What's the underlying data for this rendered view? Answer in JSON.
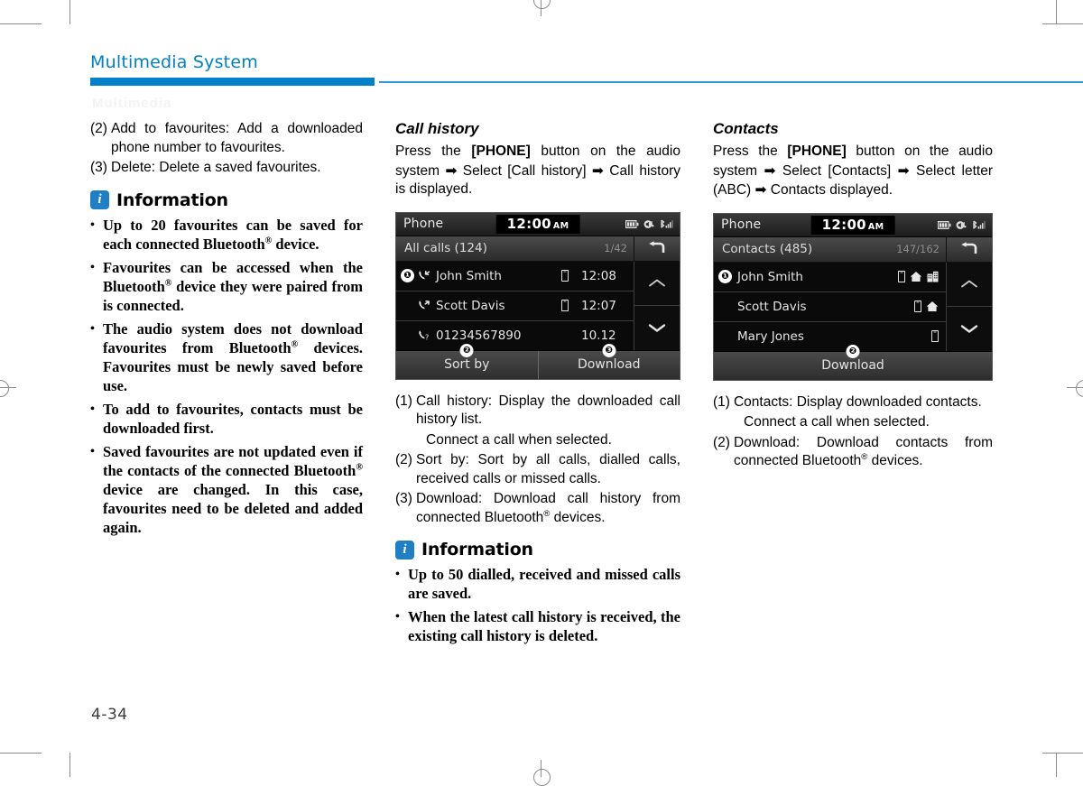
{
  "header": {
    "title": "Multimedia System",
    "ghost_text": "Multimedia"
  },
  "page_number": "4-34",
  "left_column": {
    "items": [
      {
        "marker": "(2)",
        "text": "Add to favourites: Add a downloaded phone number to favourites."
      },
      {
        "marker": "(3)",
        "text": "Delete: Delete a saved favourites."
      }
    ],
    "information": {
      "icon": "info-icon",
      "title": "Information",
      "bullets": [
        "Up to 20 favourites can be saved for each connected Bluetooth® device.",
        "Favourites can be accessed when the Bluetooth® device they were paired from is connected.",
        "The audio system does not download favourites from Bluetooth® devices. Favourites must be newly saved before use.",
        "To add to favourites, contacts must be downloaded first.",
        "Saved favourites are not updated even if the contacts of the connected Bluetooth® device are changed. In this case, favourites need to be deleted and added again."
      ]
    }
  },
  "middle_column": {
    "heading": "Call history",
    "intro_parts": {
      "p1": "Press the ",
      "bold1": "[PHONE]",
      "p2": " button on the audio system ",
      "arrow1": "➡",
      "p3": " Select [Call history] ",
      "arrow2": "➡",
      "p4": " Call history is displayed."
    },
    "device": {
      "app_name": "Phone",
      "clock_time": "12:00",
      "clock_ampm": "AM",
      "status_icons": [
        "battery-icon",
        "mute-audio-icon",
        "bluetooth-signal-icon"
      ],
      "list_title": "All calls (124)",
      "list_count": "1/42",
      "back_icon": "back-arrow-icon",
      "rows": [
        {
          "callout": "❶",
          "call_type": "incoming-call-icon",
          "name": "John Smith",
          "device_icon": "mobile-icon",
          "time": "12:08"
        },
        {
          "callout": "",
          "call_type": "outgoing-call-icon",
          "name": "Scott Davis",
          "device_icon": "mobile-icon",
          "time": "12:07"
        },
        {
          "callout": "",
          "call_type": "missed-call-icon",
          "name": "01234567890",
          "device_icon": "",
          "time": "10.12"
        }
      ],
      "scroll_up": "chevron-up-icon",
      "scroll_down": "chevron-down-icon",
      "footer_buttons": [
        {
          "callout": "❷",
          "label": "Sort by"
        },
        {
          "callout": "❸",
          "label": "Download"
        }
      ]
    },
    "items": [
      {
        "marker": "(1)",
        "text": "Call history: Display the downloaded call history list."
      },
      {
        "marker": "",
        "text": "Connect a call when selected."
      },
      {
        "marker": "(2)",
        "text": "Sort by: Sort by all calls, dialled calls, received calls or missed calls."
      },
      {
        "marker": "(3)",
        "text": "Download: Download call history from connected Bluetooth® devices."
      }
    ],
    "information": {
      "icon": "info-icon",
      "title": "Information",
      "bullets": [
        "Up to 50 dialled, received and missed calls are saved.",
        "When the latest call history is received, the existing call history is deleted."
      ]
    }
  },
  "right_column": {
    "heading": "Contacts",
    "intro_parts": {
      "p1": "Press the ",
      "bold1": "[PHONE]",
      "p2": " button on the audio system ",
      "arrow1": "➡",
      "p3": " Select [Contacts] ",
      "arrow2": "➡",
      "p4": " Select letter (ABC) ",
      "arrow3": "➡",
      "p5": " Contacts displayed."
    },
    "device": {
      "app_name": "Phone",
      "clock_time": "12:00",
      "clock_ampm": "AM",
      "status_icons": [
        "battery-icon",
        "mute-audio-icon",
        "bluetooth-signal-icon"
      ],
      "list_title": "Contacts (485)",
      "list_count": "147/162",
      "back_icon": "back-arrow-icon",
      "rows": [
        {
          "callout": "❶",
          "name": "John Smith",
          "icons": [
            "mobile-icon",
            "home-icon",
            "office-icon"
          ]
        },
        {
          "callout": "",
          "name": "Scott Davis",
          "icons": [
            "mobile-icon",
            "home-icon"
          ]
        },
        {
          "callout": "",
          "name": "Mary Jones",
          "icons": [
            "mobile-icon"
          ]
        }
      ],
      "scroll_up": "chevron-up-icon",
      "scroll_down": "chevron-down-icon",
      "footer_buttons": [
        {
          "callout": "❷",
          "label": "Download"
        }
      ]
    },
    "items": [
      {
        "marker": "(1)",
        "text": "Contacts: Display downloaded contacts."
      },
      {
        "marker": "",
        "text": "Connect a call when selected."
      },
      {
        "marker": "(2)",
        "text": "Download: Download contacts from connected Bluetooth® devices."
      }
    ]
  },
  "colors": {
    "brand_blue": "#0080c8",
    "rule_blue": "#2f9ad4",
    "info_badge": "#1f7fc4",
    "text_black": "#000000"
  }
}
